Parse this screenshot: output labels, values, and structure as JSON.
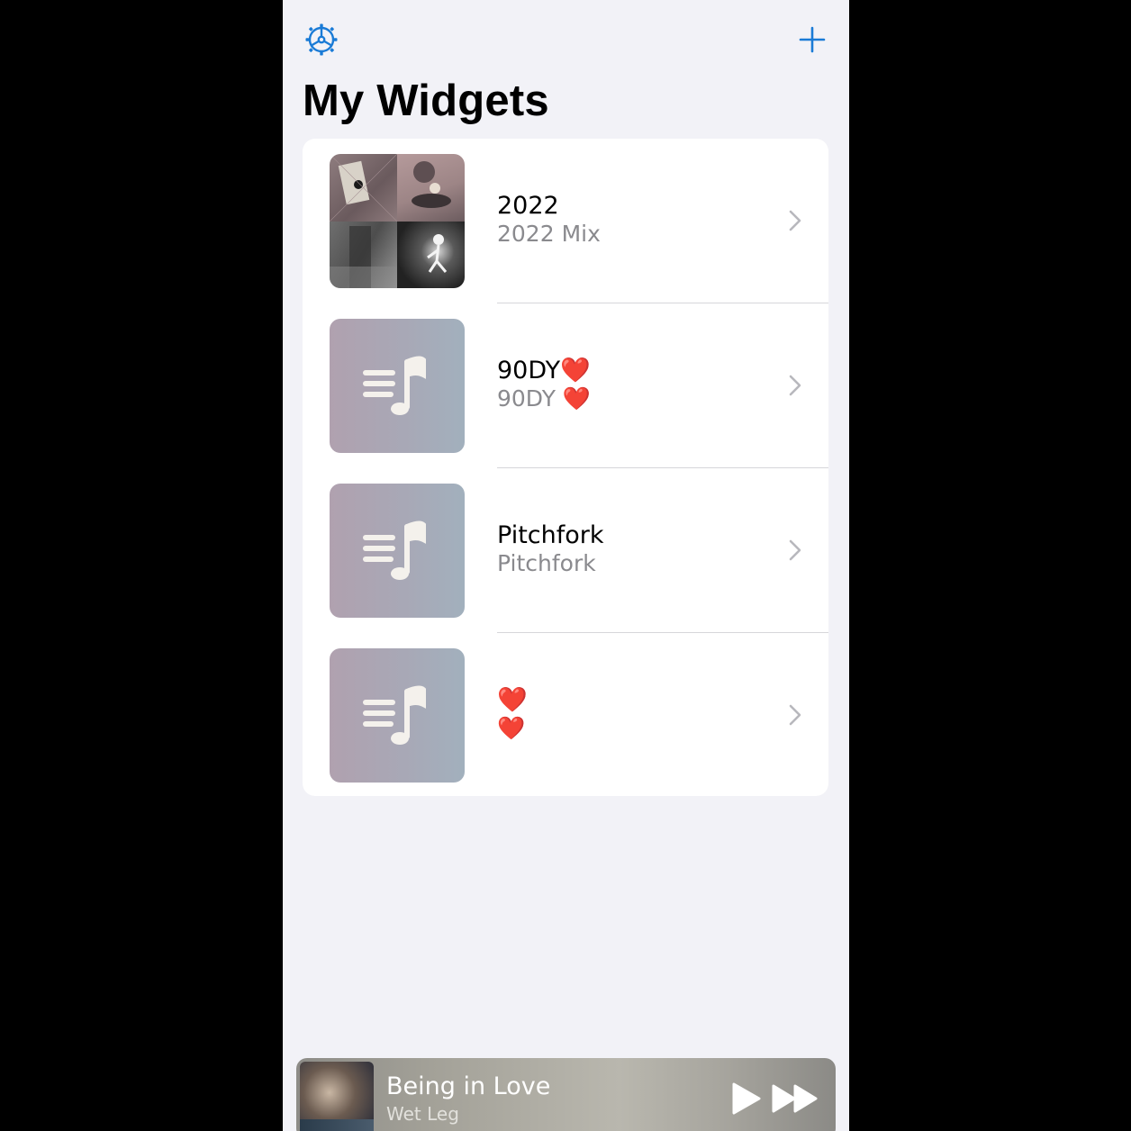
{
  "header": {
    "settings_icon": "gear-icon",
    "add_icon": "plus-icon",
    "accent_color": "#1a7bd6"
  },
  "page": {
    "title": "My Widgets"
  },
  "widgets": [
    {
      "title": "2022",
      "subtitle": "2022 Mix",
      "artwork": "album-collage"
    },
    {
      "title": "90DY❤️",
      "subtitle": "90DY ❤️",
      "artwork": "music-note-placeholder"
    },
    {
      "title": "Pitchfork",
      "subtitle": "Pitchfork",
      "artwork": "music-note-placeholder"
    },
    {
      "title": "❤️",
      "subtitle": "❤️",
      "artwork": "music-note-placeholder"
    }
  ],
  "now_playing": {
    "song": "Being in Love",
    "artist": "Wet Leg",
    "play_icon": "play-icon",
    "forward_icon": "fast-forward-icon"
  }
}
